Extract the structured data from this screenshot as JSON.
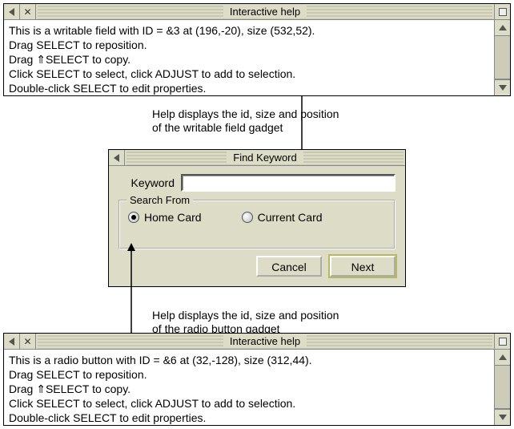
{
  "help1": {
    "title": "Interactive help",
    "lines": [
      "This is a writable field with ID = &3 at (196,-20), size (532,52).",
      "Drag SELECT to reposition.",
      "Drag ⇑SELECT to copy.",
      "Click SELECT to select, click ADJUST to add to selection.",
      "Double-click SELECT to edit properties."
    ]
  },
  "caption1": {
    "l1": "Help displays the id, size and position",
    "l2": "of the writable field gadget"
  },
  "dialog": {
    "title": "Find Keyword",
    "keyword_label": "Keyword",
    "keyword_value": "",
    "group_title": "Search From",
    "radio_home": "Home Card",
    "radio_current": "Current Card",
    "cancel": "Cancel",
    "next": "Next"
  },
  "caption2": {
    "l1": "Help displays the id, size and position",
    "l2": "of the radio button gadget"
  },
  "help2": {
    "title": "Interactive help",
    "lines": [
      "This is a radio button with ID = &6 at (32,-128), size (312,44).",
      "Drag SELECT to reposition.",
      "Drag ⇑SELECT to copy.",
      "Click SELECT to select, click ADJUST to add to selection.",
      "Double-click SELECT to edit properties."
    ]
  }
}
